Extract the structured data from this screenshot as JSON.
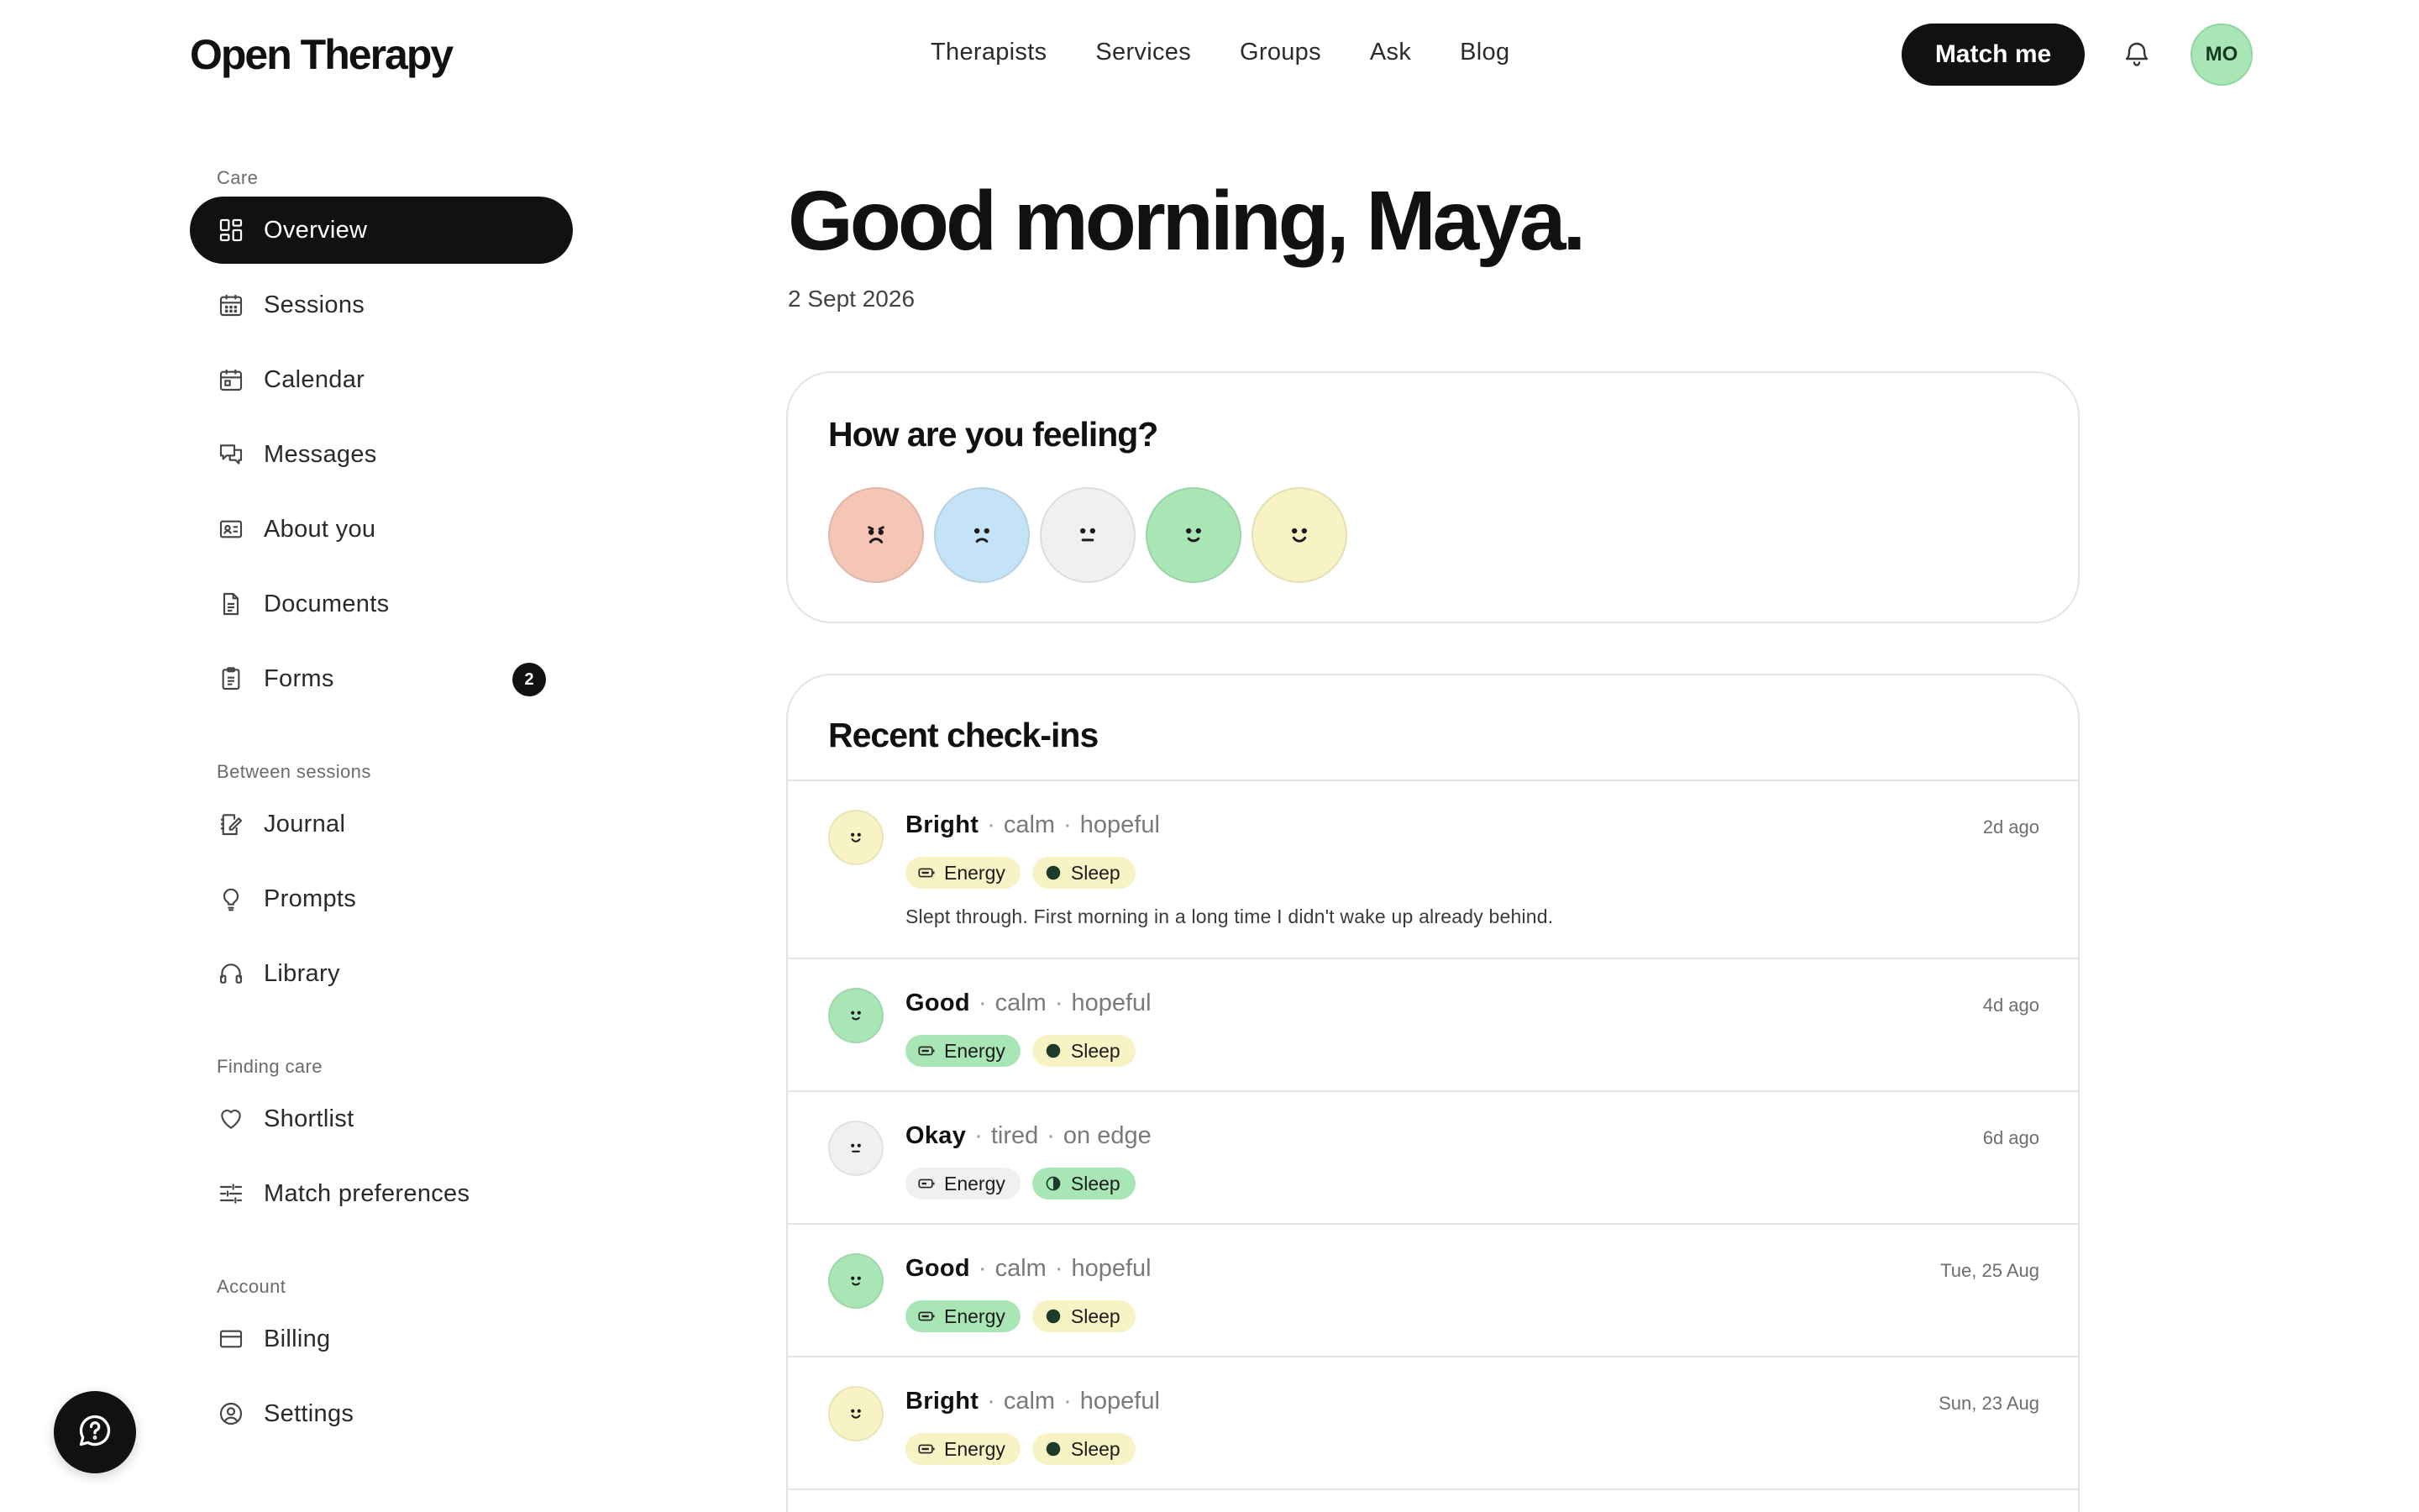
{
  "brand": "Open Therapy",
  "nav": {
    "links": [
      "Therapists",
      "Services",
      "Groups",
      "Ask",
      "Blog"
    ],
    "cta": "Match me",
    "avatar_initials": "MO"
  },
  "sidebar": {
    "sections": [
      {
        "label": "Care",
        "items": [
          {
            "label": "Overview",
            "icon": "grid-icon",
            "active": true
          },
          {
            "label": "Sessions",
            "icon": "calendar-grid-icon"
          },
          {
            "label": "Calendar",
            "icon": "calendar-icon"
          },
          {
            "label": "Messages",
            "icon": "chat-icon"
          },
          {
            "label": "About you",
            "icon": "id-card-icon"
          },
          {
            "label": "Documents",
            "icon": "document-icon"
          },
          {
            "label": "Forms",
            "icon": "clipboard-icon",
            "badge": "2"
          }
        ]
      },
      {
        "label": "Between sessions",
        "items": [
          {
            "label": "Journal",
            "icon": "journal-edit-icon"
          },
          {
            "label": "Prompts",
            "icon": "lightbulb-icon"
          },
          {
            "label": "Library",
            "icon": "headphones-icon"
          }
        ]
      },
      {
        "label": "Finding care",
        "items": [
          {
            "label": "Shortlist",
            "icon": "heart-icon"
          },
          {
            "label": "Match preferences",
            "icon": "sliders-icon"
          }
        ]
      },
      {
        "label": "Account",
        "items": [
          {
            "label": "Billing",
            "icon": "credit-card-icon"
          },
          {
            "label": "Settings",
            "icon": "user-circle-icon"
          }
        ]
      }
    ]
  },
  "main": {
    "greeting": "Good morning, Maya.",
    "date": "2 Sept 2026",
    "feeling": {
      "title": "How are you feeling?",
      "faces": [
        {
          "mood": "very-sad",
          "color": "#f5c6b6"
        },
        {
          "mood": "sad",
          "color": "#c5e3f6"
        },
        {
          "mood": "neutral",
          "color": "#f0f0f0"
        },
        {
          "mood": "good",
          "color": "#a9e6b6"
        },
        {
          "mood": "bright",
          "color": "#f7f3c4"
        }
      ]
    },
    "checkins": {
      "title": "Recent check-ins",
      "rows": [
        {
          "mood": "Bright",
          "face": "bright",
          "color": "#f7f3c4",
          "feelings": [
            "calm",
            "hopeful"
          ],
          "when": "2d ago",
          "tags": [
            {
              "label": "Energy",
              "style": "yellow",
              "icon": "battery-icon"
            },
            {
              "label": "Sleep",
              "style": "yellow",
              "icon": "moon-full-icon"
            }
          ],
          "note": "Slept through. First morning in a long time I didn't wake up already behind."
        },
        {
          "mood": "Good",
          "face": "good",
          "color": "#a9e6b6",
          "feelings": [
            "calm",
            "hopeful"
          ],
          "when": "4d ago",
          "tags": [
            {
              "label": "Energy",
              "style": "green",
              "icon": "battery-icon"
            },
            {
              "label": "Sleep",
              "style": "yellow",
              "icon": "moon-full-icon"
            }
          ]
        },
        {
          "mood": "Okay",
          "face": "neutral",
          "color": "#f0f0f0",
          "feelings": [
            "tired",
            "on edge"
          ],
          "when": "6d ago",
          "tags": [
            {
              "label": "Energy",
              "style": "grey",
              "icon": "battery-icon"
            },
            {
              "label": "Sleep",
              "style": "green",
              "icon": "moon-half-icon"
            }
          ]
        },
        {
          "mood": "Good",
          "face": "good",
          "color": "#a9e6b6",
          "feelings": [
            "calm",
            "hopeful"
          ],
          "when": "Tue, 25 Aug",
          "tags": [
            {
              "label": "Energy",
              "style": "green",
              "icon": "battery-icon"
            },
            {
              "label": "Sleep",
              "style": "yellow",
              "icon": "moon-full-icon"
            }
          ]
        },
        {
          "mood": "Bright",
          "face": "bright",
          "color": "#f7f3c4",
          "feelings": [
            "calm",
            "hopeful"
          ],
          "when": "Sun, 23 Aug",
          "tags": [
            {
              "label": "Energy",
              "style": "yellow",
              "icon": "battery-icon"
            },
            {
              "label": "Sleep",
              "style": "yellow",
              "icon": "moon-full-icon"
            }
          ]
        }
      ]
    }
  }
}
